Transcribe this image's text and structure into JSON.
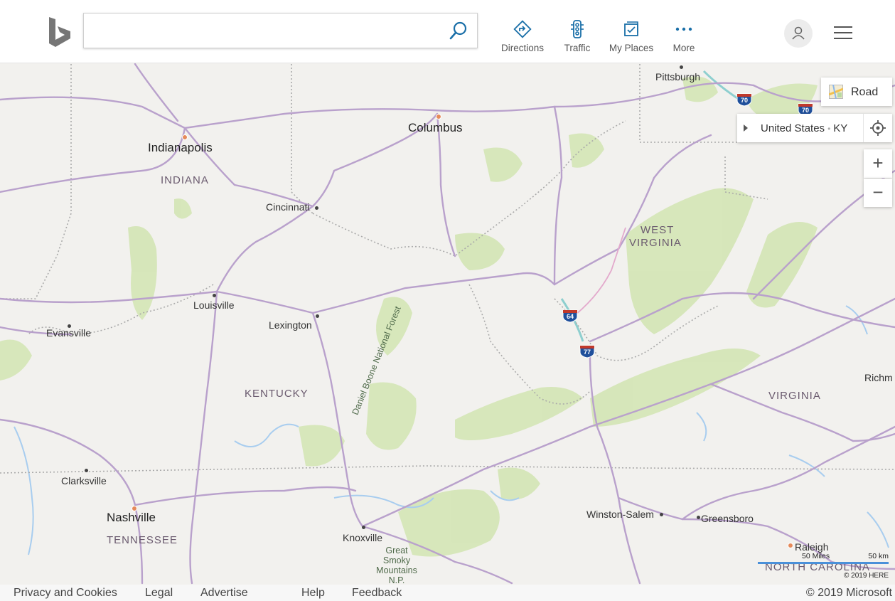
{
  "search": {
    "value": "",
    "placeholder": ""
  },
  "nav": [
    {
      "label": "Directions",
      "icon": "directions-icon"
    },
    {
      "label": "Traffic",
      "icon": "traffic-icon"
    },
    {
      "label": "My Places",
      "icon": "my-places-icon"
    },
    {
      "label": "More",
      "icon": "more-icon"
    }
  ],
  "map_controls": {
    "style_label": "Road",
    "breadcrumb_country": "United States",
    "breadcrumb_separator": "•",
    "breadcrumb_state": "KY",
    "zoom_in": "+",
    "zoom_out": "−"
  },
  "map_labels": {
    "cities": {
      "pittsburgh": "Pittsburgh",
      "columbus": "Columbus",
      "indianapolis": "Indianapolis",
      "cincinnati": "Cincinnati",
      "louisville": "Louisville",
      "lexington": "Lexington",
      "evansville": "Evansville",
      "clarksville": "Clarksville",
      "nashville": "Nashville",
      "knoxville": "Knoxville",
      "winston_salem": "Winston-Salem",
      "greensboro": "Greensboro",
      "raleigh": "Raleigh",
      "richmond": "Richm"
    },
    "states": {
      "indiana": "INDIANA",
      "west_virginia_1": "WEST",
      "west_virginia_2": "VIRGINIA",
      "kentucky": "KENTUCKY",
      "virginia": "VIRGINIA",
      "tennessee": "TENNESSEE",
      "north_carolina": "NORTH CAROLINA"
    },
    "parks": {
      "daniel_boone": "Daniel Boone National Forest",
      "smoky_1": "Great",
      "smoky_2": "Smoky",
      "smoky_3": "Mountains",
      "smoky_4": "N.P."
    },
    "interstates": [
      "70",
      "70",
      "64",
      "77"
    ]
  },
  "scale": {
    "miles": "50 Miles",
    "km": "50 km",
    "attribution": "© 2019 HERE"
  },
  "footer": {
    "privacy": "Privacy and Cookies",
    "legal": "Legal",
    "advertise": "Advertise",
    "help": "Help",
    "feedback": "Feedback",
    "copyright": "© 2019 Microsoft"
  },
  "colors": {
    "map_background": "#f2f1ee",
    "forest": "#d4e5b5",
    "water": "#a8cdef",
    "highway": "#b9a1cc",
    "interstate_shield": "#1f4f9b",
    "accent_blue": "#1a6fa8"
  }
}
